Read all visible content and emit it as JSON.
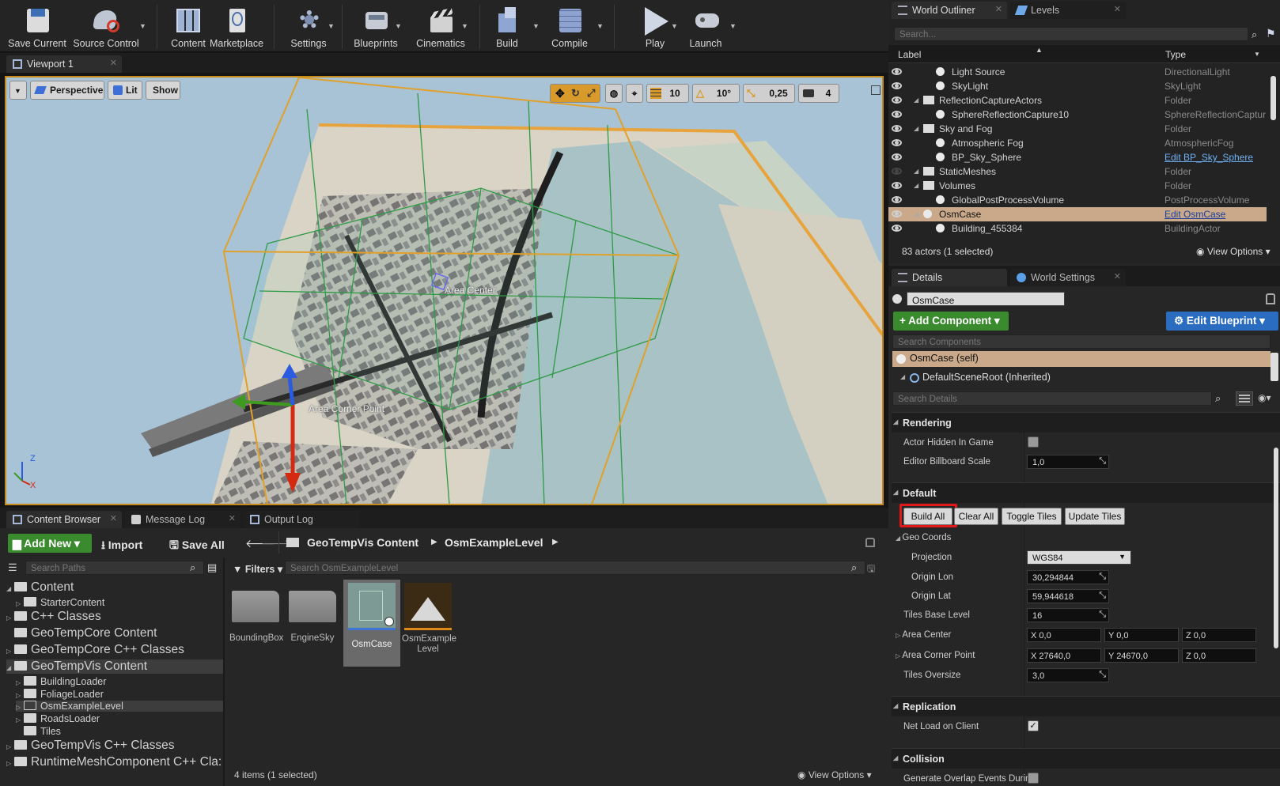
{
  "toolbar": {
    "buttons": [
      {
        "label": "Save Current",
        "icon": "save-icon"
      },
      {
        "label": "Source Control",
        "icon": "source-control-icon"
      },
      {
        "label": "Content",
        "icon": "content-icon"
      },
      {
        "label": "Marketplace",
        "icon": "marketplace-icon"
      },
      {
        "label": "Settings",
        "icon": "settings-icon"
      },
      {
        "label": "Blueprints",
        "icon": "blueprints-icon"
      },
      {
        "label": "Cinematics",
        "icon": "cinematics-icon"
      },
      {
        "label": "Build",
        "icon": "build-icon"
      },
      {
        "label": "Compile",
        "icon": "compile-icon"
      },
      {
        "label": "Play",
        "icon": "play-icon"
      },
      {
        "label": "Launch",
        "icon": "launch-icon"
      }
    ]
  },
  "viewport": {
    "tab": "Viewport 1",
    "view_mode": "Perspective",
    "lighting": "Lit",
    "show": "Show",
    "grid_snap": "10",
    "rotation_snap": "10°",
    "scale_snap": "0,25",
    "camera_speed": "4",
    "labels": {
      "area_center": "Area Center",
      "area_corner": "Area Corner Point"
    },
    "axes": {
      "x": "X",
      "z": "Z"
    }
  },
  "outliner": {
    "tab_outliner": "World Outliner",
    "tab_levels": "Levels",
    "search_placeholder": "Search...",
    "col_label": "Label",
    "col_type": "Type",
    "rows": [
      {
        "label": "Light Source",
        "type": "DirectionalLight",
        "indent": 3
      },
      {
        "label": "SkyLight",
        "type": "SkyLight",
        "indent": 3
      },
      {
        "label": "ReflectionCaptureActors",
        "type": "Folder",
        "indent": 2
      },
      {
        "label": "SphereReflectionCapture10",
        "type": "SphereReflectionCaptur",
        "indent": 3
      },
      {
        "label": "Sky and Fog",
        "type": "Folder",
        "indent": 2
      },
      {
        "label": "Atmospheric Fog",
        "type": "AtmosphericFog",
        "indent": 3
      },
      {
        "label": "BP_Sky_Sphere",
        "type": "Edit BP_Sky_Sphere",
        "indent": 3
      },
      {
        "label": "StaticMeshes",
        "type": "Folder",
        "indent": 2
      },
      {
        "label": "Volumes",
        "type": "Folder",
        "indent": 2
      },
      {
        "label": "GlobalPostProcessVolume",
        "type": "PostProcessVolume",
        "indent": 3
      },
      {
        "label": "OsmCase",
        "type": "Edit OsmCase",
        "indent": 2
      },
      {
        "label": "Building_455384",
        "type": "BuildingActor",
        "indent": 3
      }
    ],
    "status": "83 actors (1 selected)",
    "view_options": "View Options"
  },
  "details": {
    "tab_details": "Details",
    "tab_world": "World Settings",
    "actor_name": "OsmCase",
    "add_component": "+ Add Component",
    "edit_blueprint": "Edit Blueprint",
    "search_components": "Search Components",
    "comp_self": "OsmCase (self)",
    "comp_root": "DefaultSceneRoot (Inherited)",
    "search_details": "Search Details",
    "sections": {
      "rendering": "Rendering",
      "default": "Default",
      "replication": "Replication",
      "collision": "Collision"
    },
    "props": {
      "hidden": "Actor Hidden In Game",
      "billboard": "Editor Billboard Scale",
      "billboard_val": "1,0",
      "geo": "Geo Coords",
      "projection": "Projection",
      "projection_val": "WGS84",
      "origin_lon": "Origin Lon",
      "origin_lon_val": "30,294844",
      "origin_lat": "Origin Lat",
      "origin_lat_val": "59,944618",
      "tiles_base": "Tiles Base Level",
      "tiles_base_val": "16",
      "area_center": "Area Center",
      "area_center_vals": {
        "x": "X  0,0",
        "y": "Y  0,0",
        "z": "Z  0,0"
      },
      "area_corner": "Area Corner Point",
      "area_corner_vals": {
        "x": "X  27640,0",
        "y": "Y  24670,0",
        "z": "Z  0,0"
      },
      "oversize": "Tiles Oversize",
      "oversize_val": "3,0",
      "net_load": "Net Load on Client",
      "overlap": "Generate Overlap Events Durin"
    },
    "buttons": {
      "build_all": "Build All",
      "clear_all": "Clear All",
      "toggle_tiles": "Toggle Tiles",
      "update_tiles": "Update Tiles"
    }
  },
  "bottom_tabs": {
    "content_browser": "Content Browser",
    "message_log": "Message Log",
    "output_log": "Output Log"
  },
  "content_browser": {
    "add_new": "Add New",
    "import": "Import",
    "save_all": "Save All",
    "path": [
      "GeoTempVis Content",
      "OsmExampleLevel"
    ],
    "search_paths": "Search Paths",
    "filters": "Filters",
    "search_assets": "Search OsmExampleLevel",
    "tree": [
      {
        "label": "Content",
        "level": 0,
        "big": true
      },
      {
        "label": "StarterContent",
        "level": 1,
        "big": false
      },
      {
        "label": "C++ Classes",
        "level": 0,
        "big": true
      },
      {
        "label": "GeoTempCore Content",
        "level": 0,
        "big": true
      },
      {
        "label": "GeoTempCore C++ Classes",
        "level": 0,
        "big": true
      },
      {
        "label": "GeoTempVis Content",
        "level": 0,
        "big": true
      },
      {
        "label": "BuildingLoader",
        "level": 1,
        "big": false
      },
      {
        "label": "FoliageLoader",
        "level": 1,
        "big": false
      },
      {
        "label": "OsmExampleLevel",
        "level": 1,
        "big": false
      },
      {
        "label": "RoadsLoader",
        "level": 1,
        "big": false
      },
      {
        "label": "Tiles",
        "level": 1,
        "big": false
      },
      {
        "label": "GeoTempVis C++ Classes",
        "level": 0,
        "big": true
      },
      {
        "label": "RuntimeMeshComponent C++ Cla:",
        "level": 0,
        "big": true
      }
    ],
    "assets": [
      {
        "name": "BoundingBox"
      },
      {
        "name": "EngineSky"
      },
      {
        "name": "OsmCase"
      },
      {
        "name": "OsmExample Level"
      }
    ],
    "status": "4 items (1 selected)",
    "view_options": "View Options"
  },
  "colors": {
    "accent_orange": "#c68a1a",
    "selection": "#c9a98a",
    "green_button": "#3a8a2e",
    "blue_button": "#2a6cc0",
    "highlight_red": "#e01818"
  }
}
